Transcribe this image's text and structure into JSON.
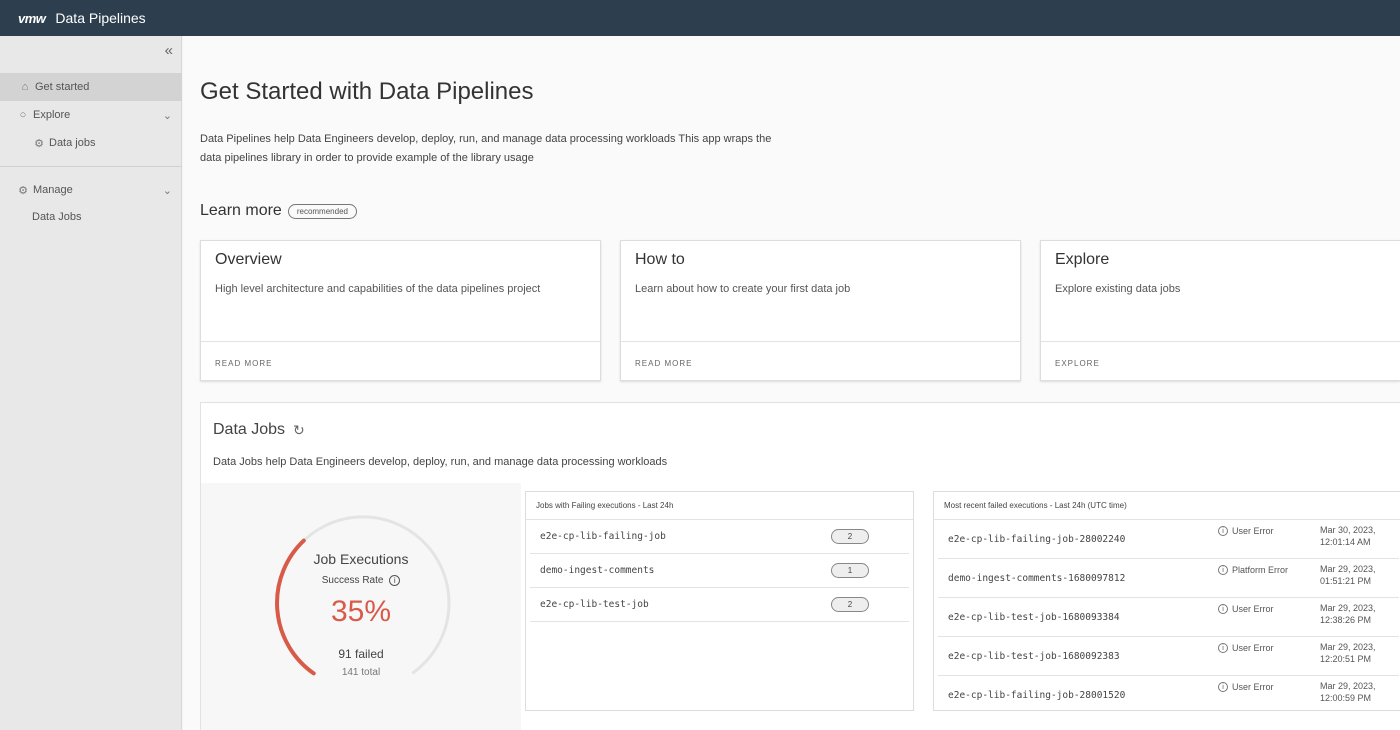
{
  "topbar": {
    "logo": "vmw",
    "title": "Data Pipelines"
  },
  "sidebar": {
    "collapse_icon": "double-chevron-left-icon",
    "items": [
      {
        "label": "Get started",
        "icon": "home-icon",
        "active": true
      },
      {
        "label": "Explore",
        "icon": "search-icon"
      },
      {
        "label": "Data jobs",
        "icon": "data-jobs-icon"
      },
      {
        "label": "Manage",
        "icon": "gear-icon"
      },
      {
        "label": "Data Jobs"
      }
    ]
  },
  "main": {
    "title": "Get Started with Data Pipelines",
    "intro_line1": "Data Pipelines help Data Engineers develop, deploy, run, and manage data processing workloads This app wraps the",
    "intro_line2": "data pipelines library in order to provide example of the library usage",
    "learn_more": "Learn more",
    "badge": "recommended",
    "cards": [
      {
        "title": "Overview",
        "description": "High level architecture and capabilities of the data pipelines project",
        "link": "READ MORE"
      },
      {
        "title": "How to",
        "description": "Learn about how to create your first data job",
        "link": "READ MORE"
      },
      {
        "title": "Explore",
        "description": "Explore existing data jobs",
        "link": "EXPLORE"
      }
    ]
  },
  "data_jobs": {
    "title": "Data Jobs",
    "description": "Data Jobs help Data Engineers develop, deploy, run, and manage data processing workloads",
    "gauge": {
      "title": "Job Executions",
      "subtitle": "Success Rate",
      "percent": "35%",
      "success_fraction": 0.35,
      "failed": "91 failed",
      "total": "141 total",
      "color": "#d85b4a"
    },
    "failing_panel": {
      "header": "Jobs with Failing executions - Last 24h",
      "rows": [
        {
          "job": "e2e-cp-lib-failing-job",
          "count": "2"
        },
        {
          "job": "demo-ingest-comments",
          "count": "1"
        },
        {
          "job": "e2e-cp-lib-test-job",
          "count": "2"
        }
      ]
    },
    "recent_panel": {
      "header": "Most recent failed executions - Last 24h (UTC time)",
      "rows": [
        {
          "execution": "e2e-cp-lib-failing-job-28002240",
          "error": "User Error",
          "date": "Mar 30, 2023,",
          "time": "12:01:14 AM"
        },
        {
          "execution": "demo-ingest-comments-1680097812",
          "error": "Platform Error",
          "date": "Mar 29, 2023,",
          "time": "01:51:21 PM"
        },
        {
          "execution": "e2e-cp-lib-test-job-1680093384",
          "error": "User Error",
          "date": "Mar 29, 2023,",
          "time": "12:38:26 PM"
        },
        {
          "execution": "e2e-cp-lib-test-job-1680092383",
          "error": "User Error",
          "date": "Mar 29, 2023,",
          "time": "12:20:51 PM"
        },
        {
          "execution": "e2e-cp-lib-failing-job-28001520",
          "error": "User Error",
          "date": "Mar 29, 2023,",
          "time": "12:00:59 PM"
        }
      ]
    }
  }
}
